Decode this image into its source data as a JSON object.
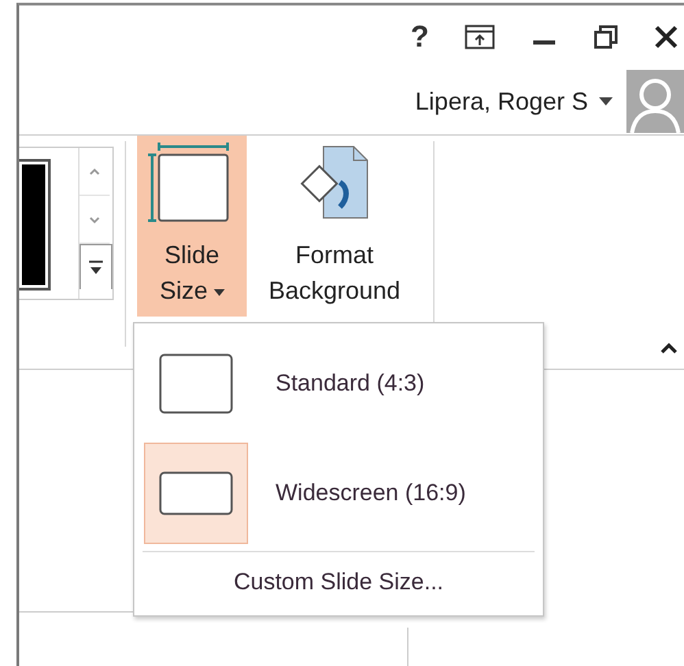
{
  "title_bar": {
    "help": "?"
  },
  "user": {
    "name": "Lipera, Roger S"
  },
  "ribbon": {
    "buttons": [
      {
        "kind": "slide-size",
        "label_lines": [
          "Slide",
          "Size"
        ],
        "dropdown": true,
        "selected": true
      },
      {
        "kind": "format-background",
        "label_lines": [
          "Format",
          "Background"
        ],
        "dropdown": false,
        "selected": false
      }
    ]
  },
  "menu": {
    "items": [
      {
        "kind": "standard",
        "label": "Standard (4:3)",
        "selected": false
      },
      {
        "kind": "widescreen",
        "label": "Widescreen (16:9)",
        "selected": true
      }
    ],
    "footer": "Custom Slide Size..."
  }
}
